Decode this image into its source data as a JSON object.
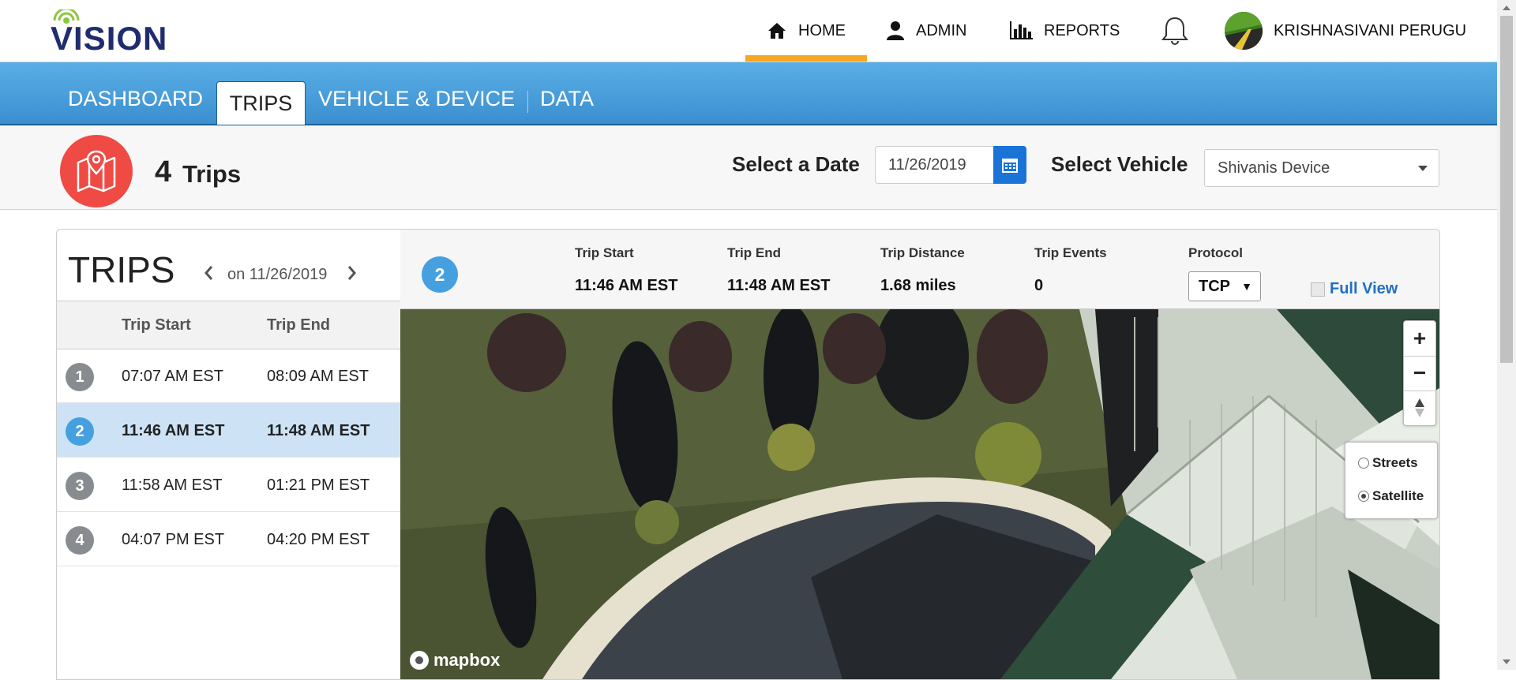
{
  "brand": {
    "logo_text": "VISION",
    "logo_color": "#1f2d6e",
    "signal_color": "#8cc63f"
  },
  "topnav": {
    "home": {
      "label": "HOME",
      "icon": "home-icon"
    },
    "admin": {
      "label": "ADMIN",
      "icon": "user-icon"
    },
    "reports": {
      "label": "REPORTS",
      "icon": "bar-chart-icon"
    },
    "notifications": {
      "icon": "bell-icon"
    },
    "user": {
      "name": "KRISHNASIVANI PERUGU",
      "icon": "avatar"
    },
    "active_underline_color": "#f5a623"
  },
  "tabs": [
    {
      "label": "DASHBOARD"
    },
    {
      "label": "TRIPS",
      "active": true
    },
    {
      "label": "VEHICLE & DEVICE"
    },
    {
      "label": "DATA"
    }
  ],
  "summary": {
    "trip_count": "4",
    "trip_count_label": "Trips",
    "select_date_label": "Select a Date",
    "date_value": "11/26/2019",
    "select_vehicle_label": "Select Vehicle",
    "vehicle_value": "Shivanis Device",
    "badge_color": "#ef4a44"
  },
  "trips_panel": {
    "title": "TRIPS",
    "date_nav": "on 11/26/2019",
    "columns": [
      "Trip Start",
      "Trip End"
    ],
    "rows": [
      {
        "num": "1",
        "start": "07:07 AM EST",
        "end": "08:09 AM EST",
        "selected": false
      },
      {
        "num": "2",
        "start": "11:46 AM EST",
        "end": "11:48 AM EST",
        "selected": true
      },
      {
        "num": "3",
        "start": "11:58 AM EST",
        "end": "01:21 PM EST",
        "selected": false
      },
      {
        "num": "4",
        "start": "04:07 PM EST",
        "end": "04:20 PM EST",
        "selected": false
      }
    ]
  },
  "detail": {
    "trip_num": "2",
    "trip_start_label": "Trip Start",
    "trip_start": "11:46 AM EST",
    "trip_end_label": "Trip End",
    "trip_end": "11:48 AM EST",
    "distance_label": "Trip Distance",
    "distance": "1.68 miles",
    "events_label": "Trip Events",
    "events": "0",
    "protocol_label": "Protocol",
    "protocol_value": "TCP",
    "full_view": "Full View"
  },
  "map": {
    "zoom_in": "+",
    "zoom_out": "−",
    "layers": [
      {
        "label": "Streets",
        "checked": false
      },
      {
        "label": "Satellite",
        "checked": true
      }
    ],
    "attribution": "mapbox"
  }
}
